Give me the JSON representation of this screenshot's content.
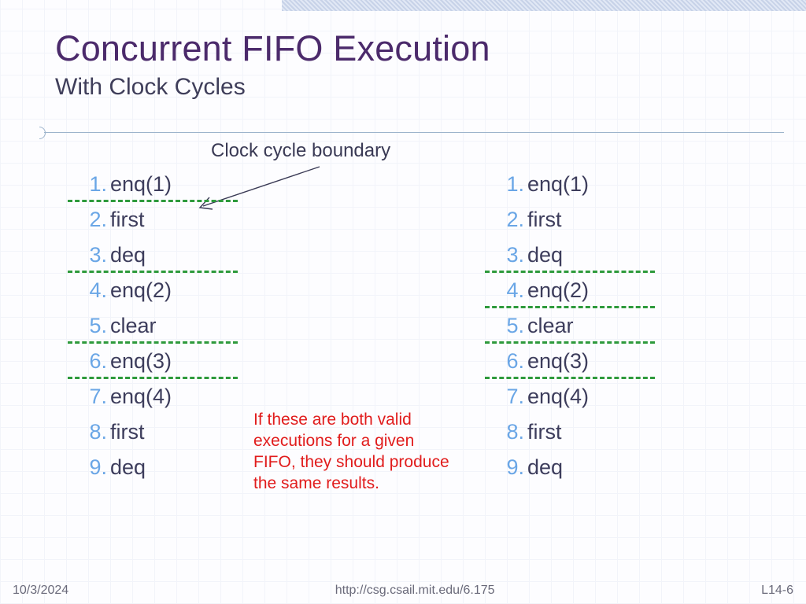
{
  "title": "Concurrent FIFO Execution",
  "subtitle": "With Clock Cycles",
  "annotation": "Clock cycle boundary",
  "note": "If these are both valid executions for a given FIFO, they should produce the same results.",
  "footer": {
    "date": "10/3/2024",
    "url": "http://csg.csail.mit.edu/6.175",
    "page": "L14-6"
  },
  "left_list": {
    "items": [
      "enq(1)",
      "first",
      "deq",
      "enq(2)",
      "clear",
      "enq(3)",
      "enq(4)",
      "first",
      "deq"
    ],
    "boundaries_after": [
      1,
      3,
      5,
      6
    ]
  },
  "right_list": {
    "items": [
      "enq(1)",
      "first",
      "deq",
      "enq(2)",
      "clear",
      "enq(3)",
      "enq(4)",
      "first",
      "deq"
    ],
    "boundaries_after": [
      3,
      4,
      5,
      6
    ]
  },
  "colors": {
    "title": "#4b2a6b",
    "list_number": "#6aa6e6",
    "list_text": "#3d3d5c",
    "boundary": "#2e9a3c",
    "note": "#e11c1c"
  }
}
